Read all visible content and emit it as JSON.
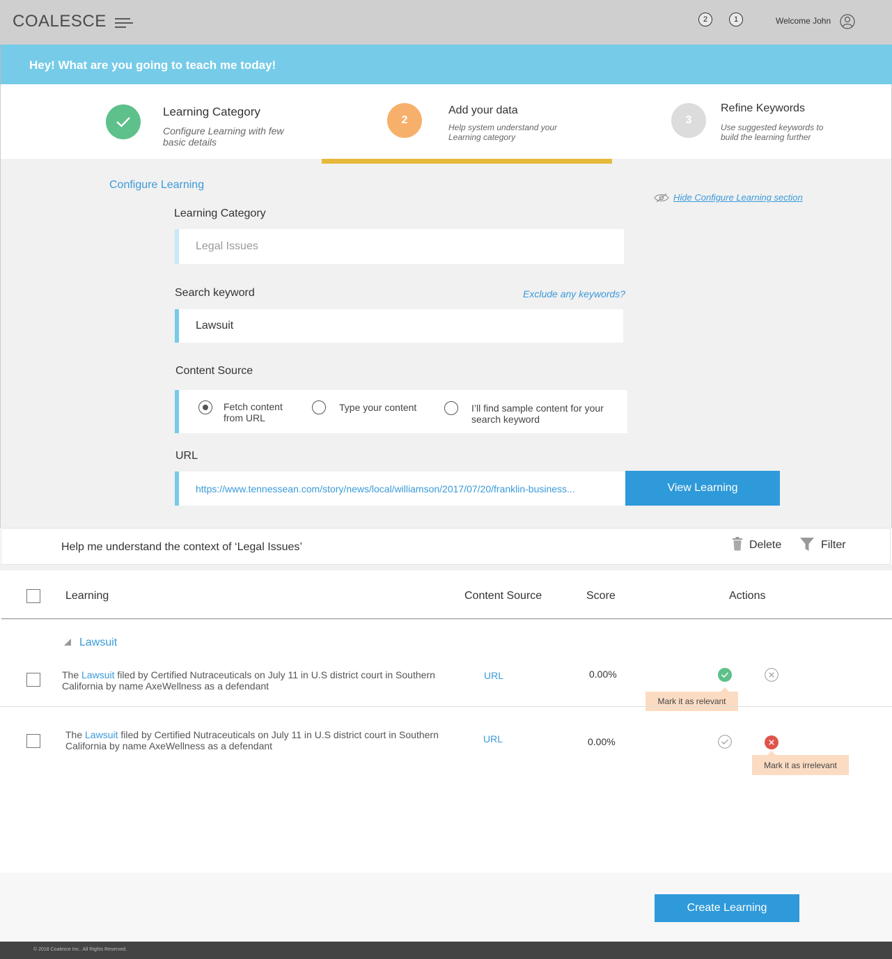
{
  "header": {
    "logo": "COALESCE",
    "badge_1": "2",
    "badge_2": "1",
    "welcome": "Welcome John"
  },
  "banner": {
    "text": "Hey! What are you going to teach me today!"
  },
  "steps": [
    {
      "number": "",
      "title": "Learning Category",
      "desc": "Configure Learning with few basic details",
      "status": "complete",
      "color": "#5ec08a"
    },
    {
      "number": "2",
      "title": "Add your data",
      "desc": "Help system understand your Learning category",
      "status": "current",
      "color": "#f7b06b"
    },
    {
      "number": "3",
      "title": "Refine Keywords",
      "desc": "Use suggested keywords to build the learning further",
      "status": "pending",
      "color": "#dcdcdc"
    }
  ],
  "config": {
    "section_title": "Configure Learning",
    "hide_link": "Hide Configure Learning section",
    "category_label": "Learning Category",
    "category_value": "Legal Issues",
    "keyword_label": "Search keyword",
    "exclude_link": "Exclude any keywords?",
    "keyword_value": "Lawsuit",
    "source_label": "Content Source",
    "source_options": [
      {
        "label": "Fetch content from URL",
        "selected": true
      },
      {
        "label": "Type your content",
        "selected": false
      },
      {
        "label": "I’ll find sample content for your search keyword",
        "selected": false
      }
    ],
    "url_label": "URL",
    "url_value": "https://www.tennessean.com/story/news/local/williamson/2017/07/20/franklin-business...",
    "view_button": "View Learning"
  },
  "context": {
    "text": "Help me understand the context of ‘Legal Issues’",
    "delete_label": "Delete",
    "filter_label": "Filter"
  },
  "table": {
    "columns": [
      "Learning",
      "Content Source",
      "Score",
      "Actions"
    ],
    "group": "Lawsuit",
    "rows": [
      {
        "prefix": "The ",
        "keyword": "Lawsuit",
        "rest": " filed by Certified Nutraceuticals on July 11 in U.S district court in Southern California by name AxeWellness as a defendant",
        "source": "URL",
        "score": "0.00%",
        "tooltip": "Mark it as relevant"
      },
      {
        "prefix": "The ",
        "keyword": "Lawsuit",
        "rest": " filed by Certified Nutraceuticals on July 11 in U.S district court in Southern California by name AxeWellness as a defendant",
        "source": "URL",
        "score": "0.00%",
        "tooltip": "Mark it as irrelevant"
      }
    ]
  },
  "create_button": "Create Learning",
  "footer": {
    "text": "© 2018 Coalesce Inc.. All Rights Reserved."
  },
  "colors": {
    "accent": "#2f9ad9",
    "banner": "#75cbe8",
    "progress": "#e7b93a",
    "relevant": "#5ec08a",
    "irrelevant": "#e0534a"
  }
}
